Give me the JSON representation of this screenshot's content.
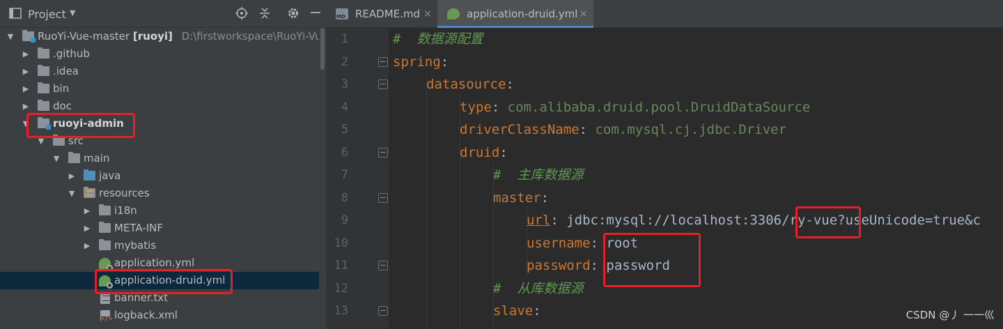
{
  "project": {
    "title": "Project",
    "root_name": "RuoYi-Vue-master",
    "root_module": "[ruoyi]",
    "root_path": "D:\\firstworkspace\\RuoYi-Vue-m",
    "items": [
      {
        "label": "RuoYi-Vue-master",
        "depth": 0
      },
      {
        "label": ".github"
      },
      {
        "label": ".idea"
      },
      {
        "label": "bin"
      },
      {
        "label": "doc"
      },
      {
        "label": "ruoyi-admin"
      },
      {
        "label": "src"
      },
      {
        "label": "main"
      },
      {
        "label": "java"
      },
      {
        "label": "resources"
      },
      {
        "label": "i18n"
      },
      {
        "label": "META-INF"
      },
      {
        "label": "mybatis"
      },
      {
        "label": "application.yml"
      },
      {
        "label": "application-druid.yml"
      },
      {
        "label": "banner.txt"
      },
      {
        "label": "logback.xml"
      }
    ]
  },
  "tabs": [
    {
      "label": "README.md",
      "close": "×"
    },
    {
      "label": "application-druid.yml",
      "close": "×"
    }
  ],
  "editor": {
    "line_numbers": [
      "1",
      "2",
      "3",
      "4",
      "5",
      "6",
      "7",
      "8",
      "9",
      "10",
      "11",
      "12",
      "13"
    ],
    "line1_comment": "#  数据源配置",
    "line2_key": "spring",
    "line3_key": "datasource",
    "line4_key": "type",
    "line4_value": "com.alibaba.druid.pool.DruidDataSource",
    "line5_key": "driverClassName",
    "line5_value": "com.mysql.cj.jdbc.Driver",
    "line6_key": "druid",
    "line7_comment": "#  主库数据源",
    "line8_key": "master",
    "line9_key": "url",
    "line9_value_a": "jdbc:mysql://localhost:3306",
    "line9_value_b": "/ry-vue",
    "line9_value_c": "?useUnicode=true&c",
    "line10_key": "username",
    "line10_value": "root",
    "line11_key": "password",
    "line11_value": "password",
    "line12_comment": "#  从库数据源",
    "line13_key": "slave"
  },
  "colors": {
    "highlight_box": "#e5202a",
    "yaml_key": "#cc7832",
    "yaml_value": "#6a8759",
    "comment": "#629755"
  },
  "watermark": "CSDN @丿 一一巛"
}
